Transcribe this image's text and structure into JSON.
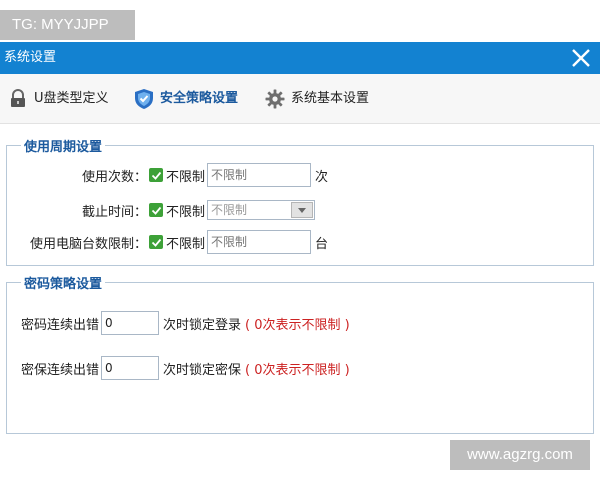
{
  "watermarks": {
    "top": "TG: MYYJJPP",
    "bottom": "www.agzrg.com"
  },
  "window": {
    "title": "系统设置"
  },
  "toolbar": {
    "items": [
      {
        "label": "U盘类型定义"
      },
      {
        "label": "安全策略设置"
      },
      {
        "label": "系统基本设置"
      }
    ]
  },
  "usage": {
    "legend": "使用周期设置",
    "count": {
      "label": "使用次数：",
      "checkbox": "不限制",
      "placeholder": "不限制",
      "unit": "次"
    },
    "deadline": {
      "label": "截止时间：",
      "checkbox": "不限制",
      "placeholder": "不限制"
    },
    "pcs": {
      "label": "使用电脑台数限制：",
      "checkbox": "不限制",
      "placeholder": "不限制",
      "unit": "台"
    }
  },
  "password": {
    "legend": "密码策略设置",
    "pwd": {
      "label": "密码连续出错",
      "value": "0",
      "suffix": "次时锁定登录",
      "hint": "( 0次表示不限制 )"
    },
    "guard": {
      "label": "密保连续出错",
      "value": "0",
      "suffix": "次时锁定密保",
      "hint": "( 0次表示不限制 )"
    }
  },
  "colors": {
    "titlebar": "#1382d1",
    "accent": "#1c5a9e",
    "check": "#3da138",
    "hint": "#cc2222"
  }
}
